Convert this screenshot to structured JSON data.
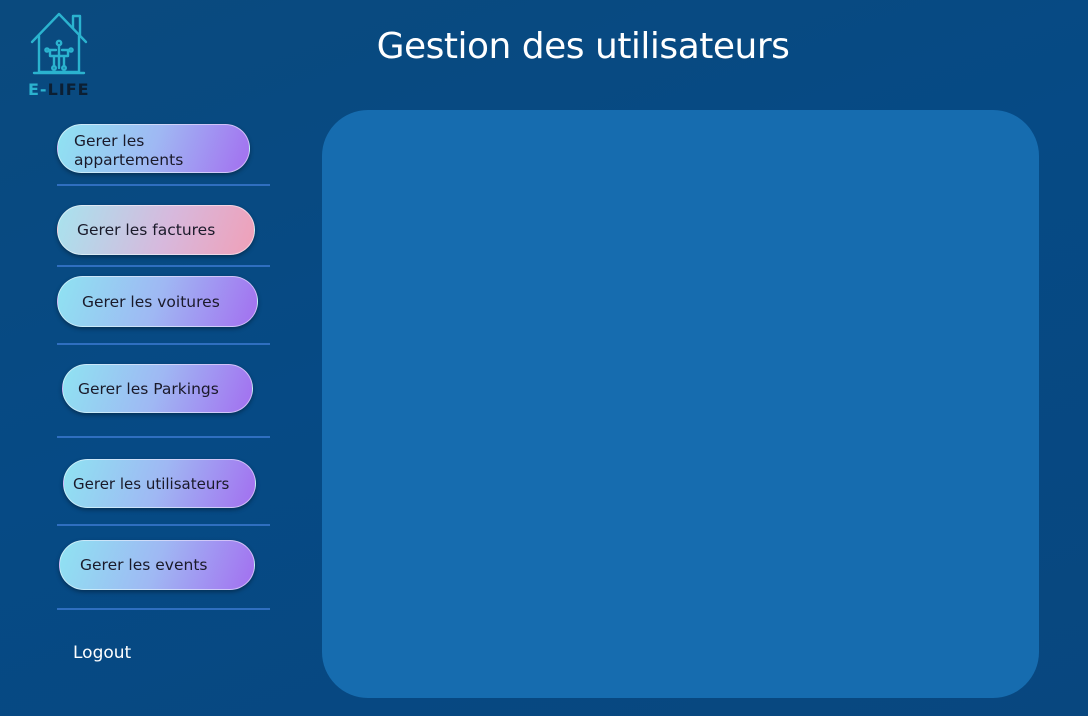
{
  "app": {
    "logo_text_accent": "E-",
    "logo_text_main": "LIFE",
    "logo_icon": "smart-home-icon",
    "accent_color": "#2bb3cf"
  },
  "header": {
    "title": "Gestion des utilisateurs"
  },
  "sidebar": {
    "items": [
      {
        "label": "Gerer les appartements"
      },
      {
        "label": "Gerer les factures"
      },
      {
        "label": "Gerer les voitures"
      },
      {
        "label": "Gerer les Parkings"
      },
      {
        "label": "Gerer les utilisateurs"
      },
      {
        "label": "Gerer les events"
      }
    ],
    "logout_label": "Logout"
  },
  "colors": {
    "background": "#064a85",
    "panel": "#166caf",
    "divider": "#2f6fc0"
  }
}
